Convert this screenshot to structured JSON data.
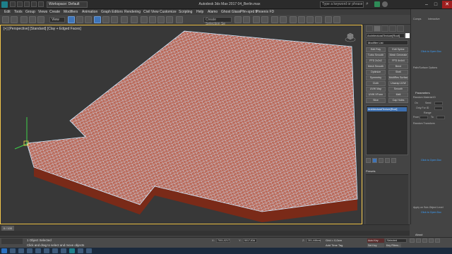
{
  "app": {
    "title": "Autodesk 3ds Max 2017    04_Berlin.max",
    "workspace": "Workspace: Default",
    "search_placeholder": "Type a keyword or phrase"
  },
  "menu": [
    "Edit",
    "Tools",
    "Group",
    "Views",
    "Create",
    "Modifiers",
    "Animation",
    "Graph Editors",
    "Rendering",
    "Civil View",
    "Customize",
    "Scripting",
    "Help",
    "Alamo",
    "Ghost Glass",
    "Pfm-sprd 5",
    "Phoenix FD"
  ],
  "toolbar": {
    "view_dropdown": "View",
    "selection_set": "Create Selection Se"
  },
  "viewport": {
    "label": "[+] [Perspective] [Standard] [Clay + Edged Faces]",
    "border_color": "#f2c64a",
    "tile_fill": "#b85a45",
    "tile_line": "#c9e8ff"
  },
  "command_panel": {
    "object_name": "ArchitecturalTexture[Roof] ",
    "modifier_list": "Modifier List",
    "buttons": [
      [
        "Edit Poly",
        "Edit Spline"
      ],
      [
        "Turbo Smooth",
        "Mesh Generate"
      ],
      [
        "FFD 2x2x2",
        "FFD 4x4x4"
      ],
      [
        "Mesh Smooth",
        "Bend"
      ],
      [
        "Optimize",
        "Shell"
      ],
      [
        "Symmetry",
        "MultiRes Surface"
      ],
      [
        "Cloth",
        "Unwrap UVW"
      ],
      [
        "UVW Map",
        "Smooth"
      ],
      [
        "UVW XForm",
        "Melt"
      ],
      [
        "Slice",
        "Cap Holes"
      ]
    ],
    "stack_item": "ArchitecturalTexture[Roof]",
    "presets_label": "Presets"
  },
  "right_panel": {
    "parameters": "Parameters",
    "random_material_id": "Random Material ID",
    "on": "On",
    "seed": "Seed",
    "only_ids": "Only For ID",
    "range": "Range",
    "from": "From",
    "to": "To",
    "random_transform": "Random Transform",
    "link_top": "Click to Open Doc",
    "path_surface": "Path/Surface Options",
    "link_mid": "Click to Open Doc",
    "apply_sub": "Apply on Sub-Object Level",
    "link_bottom": "Click to Open Doc",
    "about": "About",
    "tabs": [
      "Comps",
      "Interactive"
    ]
  },
  "bottom": {
    "time_slider": "0 / 100",
    "status_selected": "1 Object Selected",
    "status_prompt": "Click and drag to select and move objects",
    "x_label": "X:",
    "x_value": "7001,0217",
    "y_label": "Y:",
    "y_value": "5017,63d",
    "z_label": "Z:",
    "z_value": "301,446cm",
    "grid": "Grid = 0,0cm",
    "add_time_tag": "Add Time Tag",
    "auto_key": "Auto Key",
    "set_key": "Set Key",
    "selected": "Selected",
    "key_filters": "Key Filters..."
  },
  "icons": {
    "app": "3dsmax-logo-icon",
    "viewcube": "viewcube-icon",
    "search": "search-icon",
    "minimize": "minimize-icon",
    "maximize": "maximize-icon",
    "close": "close-icon"
  }
}
